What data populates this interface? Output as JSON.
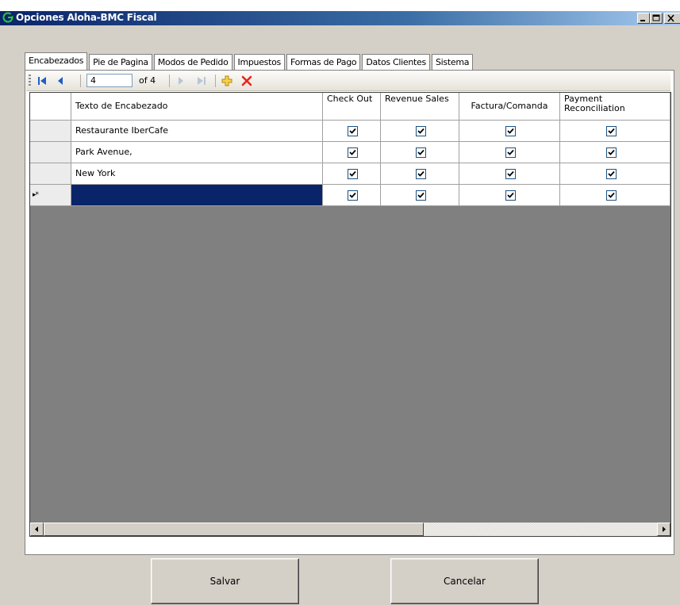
{
  "window": {
    "title": "Opciones Aloha-BMC Fiscal",
    "controls": {
      "minimize": "minimize-icon",
      "maximize": "maximize-icon",
      "close": "close-icon"
    }
  },
  "tabs": [
    {
      "label": "Encabezados",
      "active": true
    },
    {
      "label": "Pie de Pagina",
      "active": false
    },
    {
      "label": "Modos de Pedido",
      "active": false
    },
    {
      "label": "Impuestos",
      "active": false
    },
    {
      "label": "Formas de Pago",
      "active": false
    },
    {
      "label": "Datos Clientes",
      "active": false
    },
    {
      "label": "Sistema",
      "active": false
    }
  ],
  "navigator": {
    "position": "4",
    "count_text": "of 4",
    "icons": [
      "move-first-icon",
      "move-previous-icon",
      "move-next-icon",
      "move-last-icon",
      "add-new-icon",
      "delete-icon"
    ]
  },
  "grid": {
    "columns": [
      {
        "header": "Texto de Encabezado"
      },
      {
        "header": "Check Out"
      },
      {
        "header": "Revenue Sales"
      },
      {
        "header": "Factura/Comanda"
      },
      {
        "header": "Payment Reconciliation"
      }
    ],
    "rows": [
      {
        "text": "Restaurante IberCafe",
        "check_out": true,
        "revenue_sales": true,
        "factura_comanda": true,
        "payment_reconciliation": true
      },
      {
        "text": "Park Avenue,",
        "check_out": true,
        "revenue_sales": true,
        "factura_comanda": true,
        "payment_reconciliation": true
      },
      {
        "text": "New York",
        "check_out": true,
        "revenue_sales": true,
        "factura_comanda": true,
        "payment_reconciliation": true
      }
    ],
    "new_row": {
      "marker": "▸*",
      "text": "",
      "check_out": true,
      "revenue_sales": true,
      "factura_comanda": true,
      "payment_reconciliation": true
    }
  },
  "buttons": {
    "save": "Salvar",
    "cancel": "Cancelar"
  },
  "colors": {
    "title_gradient_start": "#0a246a",
    "selected_cell": "#0a246a",
    "grid_background": "#808080",
    "window_face": "#d4d0c8"
  }
}
